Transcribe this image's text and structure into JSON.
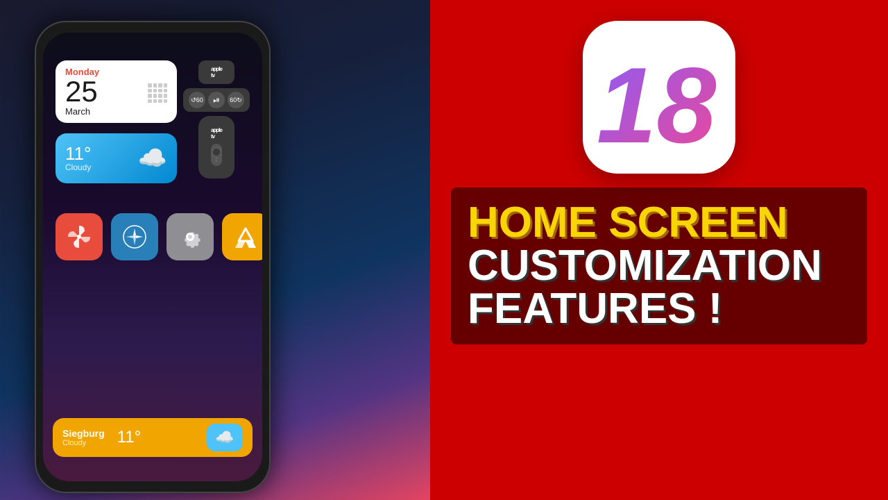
{
  "background": {
    "left_gradient_start": "#1a1a2e",
    "left_gradient_end": "#e94560",
    "right_color": "#cc0000"
  },
  "phone": {
    "calendar_widget": {
      "day_name": "Monday",
      "day_number": "25",
      "month": "March"
    },
    "weather_widget": {
      "temperature": "11°",
      "description": "Cloudy"
    },
    "appletv": {
      "label": "Apple TV"
    },
    "apps": [
      {
        "name": "Pinwheel",
        "color": "red"
      },
      {
        "name": "Compass",
        "color": "blue"
      },
      {
        "name": "Settings",
        "color": "gray"
      },
      {
        "name": "Google Drive",
        "color": "yellow"
      }
    ],
    "bottom_bar": {
      "city": "Siegburg",
      "status": "Cloudy",
      "temperature": "11°"
    }
  },
  "branding": {
    "ios_version": "18",
    "title_line1": "HOME SCREEN",
    "title_line2": "CUSTOMIZATION",
    "title_line3": "FEATURES !"
  }
}
